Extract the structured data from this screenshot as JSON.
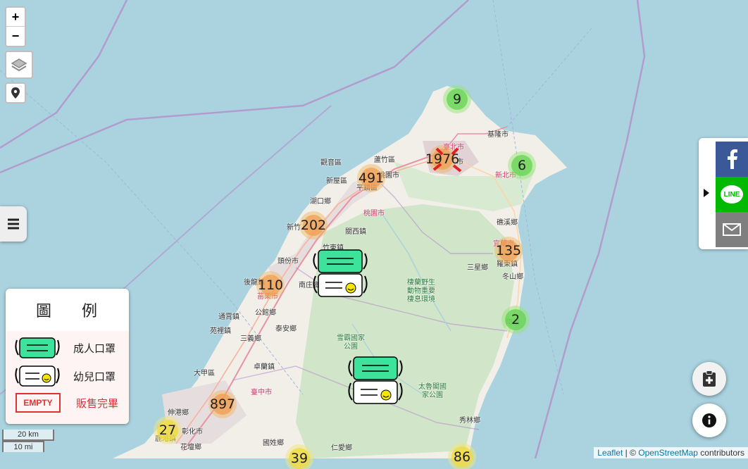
{
  "controls": {
    "zoom_in": "+",
    "zoom_out": "−",
    "layers_icon": "layers-icon",
    "locate_icon": "map-pin-icon",
    "menu_icon": "hamburger-menu-icon"
  },
  "legend": {
    "title": "圖 例",
    "items": [
      {
        "icon": "adult-mask-icon",
        "label": "成人口罩"
      },
      {
        "icon": "child-mask-icon",
        "label": "幼兒口罩"
      },
      {
        "icon": "empty-stamp-icon",
        "stamp_text": "EMPTY",
        "label": "販售完畢"
      }
    ]
  },
  "clusters": [
    {
      "count": "9",
      "color": "green"
    },
    {
      "count": "1976",
      "color": "orange"
    },
    {
      "count": "6",
      "color": "green"
    },
    {
      "count": "491",
      "color": "orange"
    },
    {
      "count": "202",
      "color": "orange"
    },
    {
      "count": "135",
      "color": "orange"
    },
    {
      "count": "110",
      "color": "orange"
    },
    {
      "count": "2",
      "color": "green"
    },
    {
      "count": "897",
      "color": "orange"
    },
    {
      "count": "27",
      "color": "yellow"
    },
    {
      "count": "39",
      "color": "yellow"
    },
    {
      "count": "86",
      "color": "yellow"
    }
  ],
  "places": {
    "jilong": "基隆市",
    "taipei": "臺北市",
    "taipei2": "市",
    "xinbei": "新北市",
    "guanyin": "觀音區",
    "luzhu": "蘆竹區",
    "xinwu": "新屋區",
    "pingzhen": "平鎮區",
    "taoyuan_city": "桃園市",
    "taoyuan": "桃園市",
    "hukou": "湖口鄉",
    "xinzhu": "新竹",
    "guanxi": "關西鎮",
    "zhudong": "竹東鎮",
    "toufen": "頭份市",
    "nanzhuang": "南庄鄉",
    "houlong": "後龍鎮",
    "miaoli": "苗栗市",
    "gongguan": "公館鄉",
    "tongxiao": "通霄鎮",
    "yuanli": "苑裡鎮",
    "taian": "泰安鄉",
    "sanyi": "三義鄉",
    "zhuolan": "卓蘭鎮",
    "taichung": "臺中市",
    "dajia": "大甲區",
    "shengang": "伸港鄉",
    "changhua": "彰化市",
    "huatan": "花壇鄉",
    "guoxing": "國姓鄉",
    "renai": "仁愛鄉",
    "jiaoxi": "礁溪鄉",
    "yilan": "宜蘭市",
    "luodong": "羅東鎮",
    "sanxing": "三星鄉",
    "dongshan": "冬山鄉",
    "nanao": "南澳",
    "xiulin": "秀林鄉",
    "wildlife": "棲蘭野生\n動物重要\n棲息環境",
    "shei_pa": "雪霸國家\n公園",
    "taroko": "太魯閣國\n家公園",
    "lugang": "鹿港鎮"
  },
  "scale": {
    "metric": "20 km",
    "imperial": "10 mi"
  },
  "share": {
    "facebook_icon": "facebook-icon",
    "line_icon": "line-icon",
    "line_text": "LINE",
    "mail_icon": "mail-icon",
    "toggle_icon": "caret-right-icon"
  },
  "buttons": {
    "clipboard_icon": "clipboard-plus-icon",
    "info_icon": "info-icon"
  },
  "attribution": {
    "leaflet": "Leaflet",
    "sep": " | © ",
    "osm": "OpenStreetMap",
    "suffix": " contributors"
  }
}
